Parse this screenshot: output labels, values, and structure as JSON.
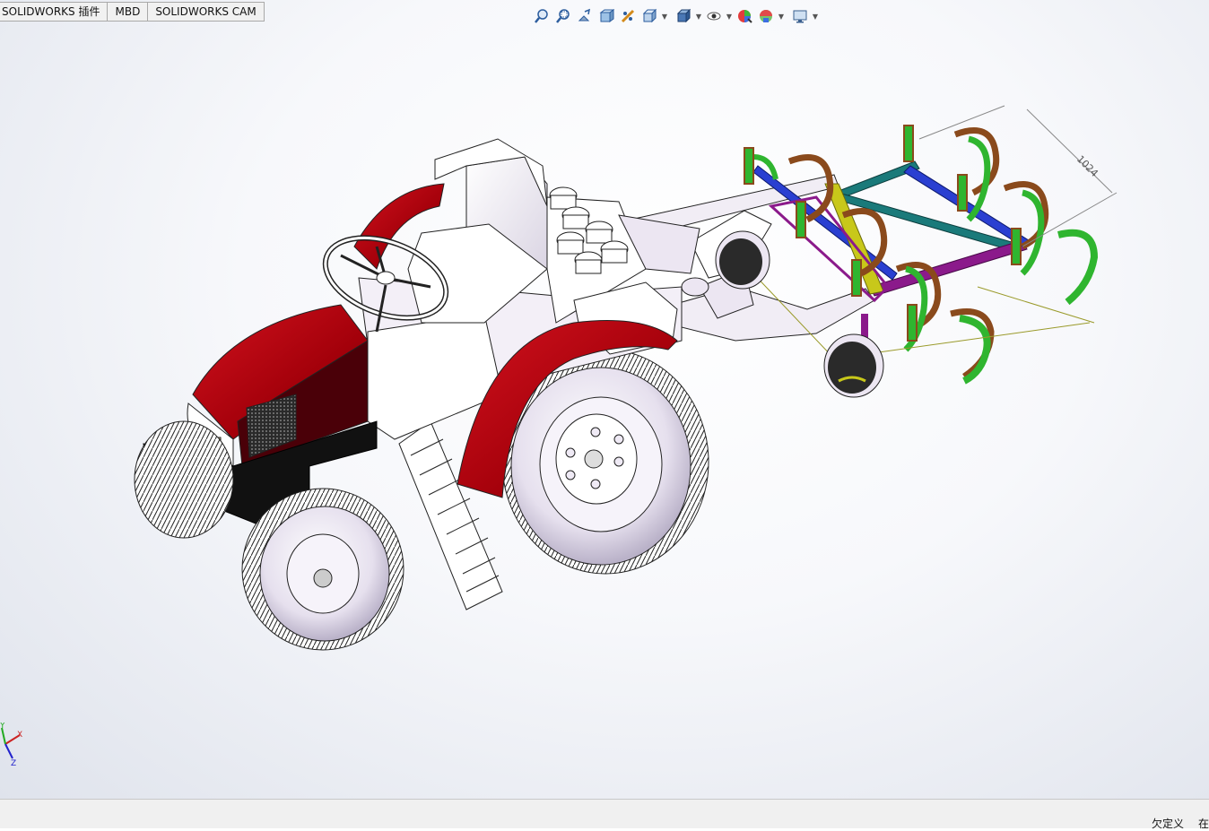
{
  "tabs": [
    {
      "label": "SOLIDWORKS 插件"
    },
    {
      "label": "MBD"
    },
    {
      "label": "SOLIDWORKS CAM"
    }
  ],
  "heads_up_toolbar": {
    "items": [
      {
        "icon": "zoom-to-fit-icon"
      },
      {
        "icon": "zoom-to-area-icon"
      },
      {
        "icon": "previous-view-icon"
      },
      {
        "icon": "section-view-icon"
      },
      {
        "icon": "dynamic-annotation-views-icon"
      },
      {
        "icon": "view-orientation-icon",
        "has_dropdown": true
      },
      {
        "icon": "display-style-icon",
        "has_dropdown": true
      },
      {
        "icon": "hide-show-items-icon",
        "has_dropdown": true
      },
      {
        "icon": "edit-appearance-icon"
      },
      {
        "icon": "apply-scene-icon",
        "has_dropdown": true
      },
      {
        "icon": "view-settings-icon",
        "has_dropdown": true
      }
    ]
  },
  "model": {
    "dimension_label": "1024",
    "colors": {
      "body_red": "#a3000a",
      "body_white": "#ffffff",
      "tire_lavender": "#e9e4f0",
      "frame_teal": "#1a7a7a",
      "frame_purple": "#8b1a8b",
      "frame_blue": "#2a3fd1",
      "tine_green": "#2fb52f",
      "tine_brown": "#8a4a1c",
      "link_yellow": "#c8c81a"
    }
  },
  "triad": {
    "x_label": "X",
    "y_label": "Y",
    "z_label": "Z"
  },
  "status": {
    "state": "欠定义",
    "extra": "在"
  }
}
